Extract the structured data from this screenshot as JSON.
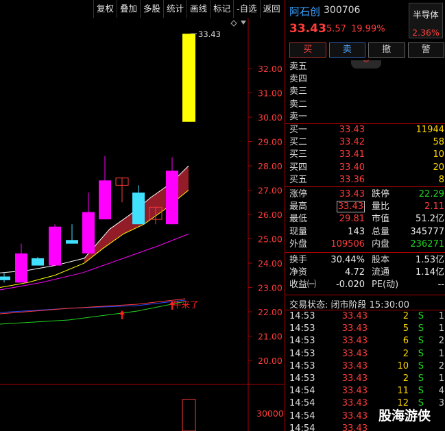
{
  "toolbar": {
    "items": [
      "复权",
      "叠加",
      "多股",
      "统计",
      "画线",
      "标记",
      "-自选",
      "返回"
    ]
  },
  "chart": {
    "max_label": "33.43",
    "annotation": "牛来了",
    "price_axis": [
      "32.00",
      "31.00",
      "30.00",
      "29.00",
      "28.00",
      "27.00",
      "26.00",
      "25.00",
      "24.00",
      "23.00",
      "22.00",
      "21.00",
      "20.00"
    ],
    "volume_axis": [
      "30000"
    ],
    "colors": {
      "up": "#ff00ff",
      "down": "#40e0ff",
      "limit_up": "#ffff00",
      "ma_short": "#ffffff",
      "ma_mid": "#ffff00",
      "ma_long": "#ff00ff"
    }
  },
  "quote": {
    "name": "阿石创",
    "code": "300706",
    "price": "33.43",
    "change": "5.57",
    "change_pct": "19.99%",
    "sector_name": "半导体",
    "sector_pct": "2.36%"
  },
  "actions": {
    "buy": "买",
    "sell": "卖",
    "cancel": "撤",
    "alert": "警"
  },
  "ask": [
    {
      "label": "卖五",
      "price": "",
      "vol": ""
    },
    {
      "label": "卖四",
      "price": "",
      "vol": ""
    },
    {
      "label": "卖三",
      "price": "",
      "vol": ""
    },
    {
      "label": "卖二",
      "price": "",
      "vol": ""
    },
    {
      "label": "卖一",
      "price": "",
      "vol": ""
    }
  ],
  "bid": [
    {
      "label": "买一",
      "price": "33.43",
      "vol": "11944"
    },
    {
      "label": "买二",
      "price": "33.42",
      "vol": "58"
    },
    {
      "label": "买三",
      "price": "33.41",
      "vol": "10"
    },
    {
      "label": "买四",
      "price": "33.40",
      "vol": "20"
    },
    {
      "label": "买五",
      "price": "33.36",
      "vol": "8"
    }
  ],
  "stats": [
    {
      "l1": "涨停",
      "v1": "33.43",
      "c1": "red",
      "l2": "跌停",
      "v2": "22.29",
      "c2": "green"
    },
    {
      "l1": "最高",
      "v1": "33.43",
      "c1": "red boxed",
      "l2": "量比",
      "v2": "2.11",
      "c2": "red"
    },
    {
      "l1": "最低",
      "v1": "29.81",
      "c1": "red",
      "l2": "市值",
      "v2": "51.2亿",
      "c2": "white"
    },
    {
      "l1": "现量",
      "v1": "143",
      "c1": "white",
      "l2": "总量",
      "v2": "345777",
      "c2": "white"
    },
    {
      "l1": "外盘",
      "v1": "109506",
      "c1": "red",
      "l2": "内盘",
      "v2": "236271",
      "c2": "green"
    }
  ],
  "stats2": [
    {
      "l1": "换手",
      "v1": "30.44%",
      "l2": "股本",
      "v2": "1.53亿"
    },
    {
      "l1": "净资",
      "v1": "4.72",
      "l2": "流通",
      "v2": "1.14亿"
    },
    {
      "l1": "收益㈠",
      "v1": "-0.020",
      "l2": "PE(动)",
      "v2": "--"
    }
  ],
  "status": "交易状态: 闭市阶段 15:30:00",
  "ticks": [
    {
      "t": "14:53",
      "p": "33.43",
      "q": "2",
      "d": "S",
      "n": "1"
    },
    {
      "t": "14:53",
      "p": "33.43",
      "q": "5",
      "d": "S",
      "n": "1"
    },
    {
      "t": "14:53",
      "p": "33.43",
      "q": "6",
      "d": "S",
      "n": "2"
    },
    {
      "t": "14:53",
      "p": "33.43",
      "q": "2",
      "d": "S",
      "n": "1"
    },
    {
      "t": "14:53",
      "p": "33.43",
      "q": "10",
      "d": "S",
      "n": "2"
    },
    {
      "t": "14:53",
      "p": "33.43",
      "q": "2",
      "d": "S",
      "n": "1"
    },
    {
      "t": "14:54",
      "p": "33.43",
      "q": "11",
      "d": "S",
      "n": "4"
    },
    {
      "t": "14:54",
      "p": "33.43",
      "q": "12",
      "d": "S",
      "n": "3"
    },
    {
      "t": "14:54",
      "p": "33.43",
      "q": "",
      "d": "",
      "n": ""
    },
    {
      "t": "14:54",
      "p": "33.43",
      "q": "",
      "d": "",
      "n": ""
    }
  ],
  "watermark": "股海游侠"
}
